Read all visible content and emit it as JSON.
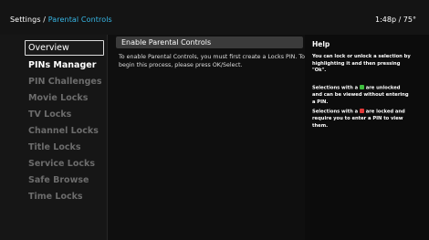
{
  "header": {
    "breadcrumb_root": "Settings",
    "breadcrumb_separator": " / ",
    "breadcrumb_current": "Parental Controls",
    "clock": "1:48p / 75°"
  },
  "sidebar": {
    "items": [
      {
        "label": "Overview",
        "state": "selected"
      },
      {
        "label": "PINs Manager",
        "state": "enabled"
      },
      {
        "label": "PIN Challenges",
        "state": "disabled"
      },
      {
        "label": "Movie Locks",
        "state": "disabled"
      },
      {
        "label": "TV Locks",
        "state": "disabled"
      },
      {
        "label": "Channel Locks",
        "state": "disabled"
      },
      {
        "label": "Title Locks",
        "state": "disabled"
      },
      {
        "label": "Service Locks",
        "state": "disabled"
      },
      {
        "label": "Safe Browse",
        "state": "disabled"
      },
      {
        "label": "Time Locks",
        "state": "disabled"
      }
    ]
  },
  "main": {
    "section_title": "Enable Parental Controls",
    "body_line_1": "To enable Parental Controls, you must first create a Locks PIN. To",
    "body_line_2": "begin this process, please press OK/Select."
  },
  "help": {
    "title": "Help",
    "para1_line_1": "You can lock or unlock a selection by",
    "para1_line_2": "highlighting it and then pressing",
    "para1_line_3": "\"Ok\".",
    "para2_line_1a": "Selections with a",
    "para2_line_1b": "are unlocked",
    "para2_line_2": "and can be viewed without entering",
    "para2_line_3": "a PIN.",
    "para3_line_1a": "Selections with a",
    "para3_line_1b": "are locked and",
    "para3_line_2": "require you to enter a PIN to view",
    "para3_line_3": "them.",
    "unlocked_icon": "unlocked-lock-icon",
    "locked_icon": "locked-lock-icon"
  },
  "colors": {
    "accent": "#37b7e6",
    "unlocked": "#3fbf3f",
    "locked": "#e23a3a",
    "disabled_text": "#6c6c6c"
  }
}
